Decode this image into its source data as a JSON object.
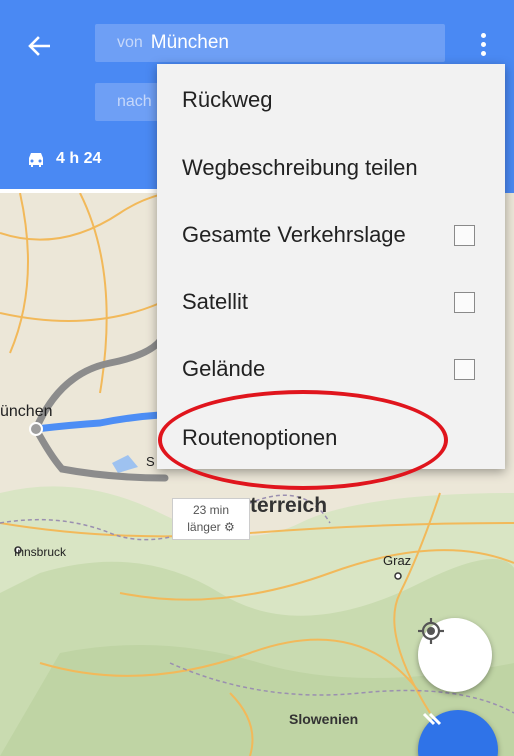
{
  "header": {
    "from_prefix": "von",
    "from_value": "München",
    "to_prefix": "nach",
    "mode_duration": "4 h 24"
  },
  "menu": {
    "items": [
      {
        "label": "Rückweg",
        "has_checkbox": false
      },
      {
        "label": "Wegbeschreibung teilen",
        "has_checkbox": false
      },
      {
        "label": "Gesamte Verkehrslage",
        "has_checkbox": true,
        "checked": false
      },
      {
        "label": "Satellit",
        "has_checkbox": true,
        "checked": false
      },
      {
        "label": "Gelände",
        "has_checkbox": true,
        "checked": false
      },
      {
        "label": "Routenoptionen",
        "has_checkbox": false,
        "highlighted": true
      }
    ]
  },
  "map": {
    "labels": {
      "muenchen": "ünchen",
      "s": "S",
      "oesterreich": "terreich",
      "innsbruck": "Innsbruck",
      "graz": "Graz",
      "slowenien": "Slowenien"
    },
    "alt_route": {
      "line1": "23 min",
      "line2": "länger"
    }
  },
  "colors": {
    "header_bg": "#4a89f3",
    "field_bg": "#6e9ff5",
    "route_primary": "#4d8ef5",
    "route_alt": "#9e9e9e",
    "highlight": "#e0151d",
    "fab_nav": "#2f73e8"
  },
  "icons": {
    "back": "arrow-back-icon",
    "more": "more-vert-icon",
    "car": "car-icon",
    "location": "my-location-icon",
    "navigate": "navigation-icon"
  }
}
